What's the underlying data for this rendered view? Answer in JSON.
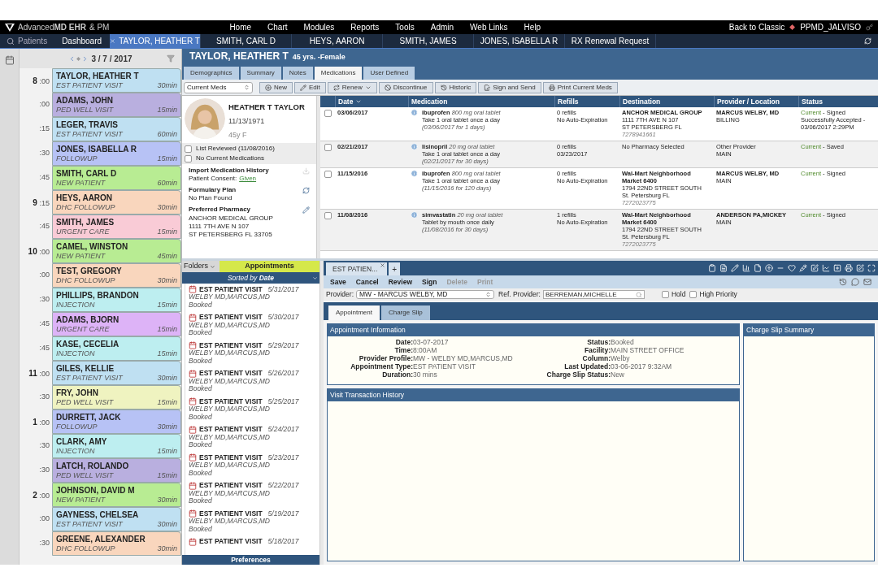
{
  "top_bar": {
    "logo": "Advanced**MD EHR**",
    "logo_suffix": "& PM",
    "menu": [
      "Home",
      "Chart",
      "Modules",
      "Reports",
      "Tools",
      "Admin",
      "Web Links",
      "Help"
    ],
    "back_link": "Back to Classic",
    "user": "PPMD_JALVISO"
  },
  "tab_bar": {
    "search_label": "Patients",
    "dashboard": "Dashboard",
    "tabs": [
      {
        "label": "TAYLOR, HEATHER T",
        "selected": true
      },
      {
        "label": "SMITH, CARL D",
        "selected": false
      },
      {
        "label": "HEYS, AARON",
        "selected": false
      },
      {
        "label": "SMITH, JAMES",
        "selected": false
      },
      {
        "label": "JONES, ISABELLA R",
        "selected": false
      },
      {
        "label": "RX Renewal Request",
        "selected": false
      }
    ]
  },
  "schedule": {
    "date": "3 / 7 / 2017",
    "appointments": [
      {
        "hour": "8",
        "minute": ":00",
        "name": "TAYLOR, HEATHER T",
        "type": "EST PATIENT VISIT",
        "duration": "30min",
        "color": "#bfe0f2"
      },
      {
        "minute": ":00",
        "name": "ADAMS, JOHN",
        "type": "PED WELL VISIT",
        "duration": "15min",
        "color": "#b9afdf"
      },
      {
        "minute": ":15",
        "name": "LEGER, TRAVIS",
        "type": "EST PATIENT VISIT",
        "duration": "60min",
        "color": "#bfe0f2"
      },
      {
        "minute": ":30",
        "name": "JONES, ISABELLA R",
        "type": "FOLLOWUP",
        "duration": "15min",
        "color": "#b7c2f5"
      },
      {
        "minute": ":45",
        "name": "SMITH, CARL D",
        "type": "NEW PATIENT",
        "duration": "60min",
        "color": "#b8ec93"
      },
      {
        "hour": "9",
        "minute": ":15",
        "name": "HEYS, AARON",
        "type": "DHC FOLLOWUP",
        "duration": "30min",
        "color": "#f9d6bd"
      },
      {
        "minute": ":45",
        "name": "SMITH, JAMES",
        "type": "URGENT CARE",
        "duration": "15min",
        "color": "#f9cbd6"
      },
      {
        "hour": "10",
        "minute": ":00",
        "name": "CAMEL, WINSTON",
        "type": "NEW PATIENT",
        "duration": "45min",
        "color": "#b8ec93"
      },
      {
        "minute": ":00",
        "name": "TEST, GREGORY",
        "type": "DHC FOLLOWUP",
        "duration": "30min",
        "color": "#f9d6bd"
      },
      {
        "minute": ":30",
        "name": "PHILLIPS, BRANDON",
        "type": "INJECTION",
        "duration": "15min",
        "color": "#bdeef0"
      },
      {
        "minute": ":45",
        "name": "ADAMS, BJORN",
        "type": "URGENT CARE",
        "duration": "15min",
        "color": "#ddb3f7"
      },
      {
        "minute": ":45",
        "name": "KASE, CECELIA",
        "type": "INJECTION",
        "duration": "15min",
        "color": "#bdeef0"
      },
      {
        "hour": "11",
        "minute": ":00",
        "name": "GILES, KELLIE",
        "type": "EST PATIENT VISIT",
        "duration": "30min",
        "color": "#bfe0f2"
      },
      {
        "minute": ":30",
        "name": "FRY, JOHN",
        "type": "PED WELL VISIT",
        "duration": "15min",
        "color": "#eff3c0"
      },
      {
        "hour": "1",
        "minute": ":00",
        "name": "DURRETT, JACK",
        "type": "FOLLOWUP",
        "duration": "30min",
        "color": "#b7c2f5"
      },
      {
        "minute": ":30",
        "name": "CLARK, AMY",
        "type": "INJECTION",
        "duration": "15min",
        "color": "#bdeef0"
      },
      {
        "minute": ":30",
        "name": "LATCH, ROLANDO",
        "type": "PED WELL VISIT",
        "duration": "15min",
        "color": "#b9afdf"
      },
      {
        "hour": "2",
        "minute": ":00",
        "name": "JOHNSON, DAVID M",
        "type": "NEW PATIENT",
        "duration": "30min",
        "color": "#b8ec93"
      },
      {
        "minute": ":00",
        "name": "GAYNESS, CHELSEA",
        "type": "EST PATIENT VISIT",
        "duration": "30min",
        "color": "#bfe0f2"
      },
      {
        "minute": ":30",
        "name": "GREENE, ALEXANDER",
        "type": "DHC FOLLOWUP",
        "duration": "30min",
        "color": "#f9d6bd"
      }
    ]
  },
  "patient_header": {
    "name": "TAYLOR, HEATHER T",
    "info": "45 yrs. -Female"
  },
  "chart_tabs": [
    {
      "label": "Demographics",
      "selected": false
    },
    {
      "label": "Summary",
      "selected": false
    },
    {
      "label": "Notes",
      "selected": false
    },
    {
      "label": "Medications",
      "selected": true
    },
    {
      "label": "User Defined",
      "selected": false
    }
  ],
  "med_toolbar": {
    "filter": "Current Meds",
    "buttons": [
      {
        "label": "New",
        "kind": "new"
      },
      {
        "label": "Edit",
        "kind": "edit"
      },
      {
        "label": "Renew",
        "kind": "renew"
      },
      {
        "label": "Discontinue",
        "kind": "discontinue"
      },
      {
        "label": "Historic",
        "kind": "historic"
      },
      {
        "label": "Sign and Send",
        "kind": "sign"
      },
      {
        "label": "Print Current Meds",
        "kind": "print"
      }
    ]
  },
  "patient_card": {
    "name": "HEATHER T TAYLOR",
    "dob": "11/13/1971",
    "age_sex": "45y F",
    "checks": [
      {
        "label": "List Reviewed (11/08/2016)",
        "checked": false
      },
      {
        "label": "No Current Medications",
        "checked": false
      }
    ],
    "import_title": "Import Medication History",
    "consent_label": "Patient Consent:",
    "consent_value": "Given",
    "formulary_title": "Formulary Plan",
    "formulary_value": "No Plan Found",
    "pharmacy_title": "Preferred Pharmacy",
    "pharmacy_lines": [
      "ANCHOR MEDICAL GROUP",
      "1111 7TH AVE N 107",
      "ST PETERSBERG FL 33705"
    ]
  },
  "medications": {
    "columns": [
      "Date",
      "Medication",
      "Refills",
      "Destination",
      "Provider / Location",
      "Status"
    ],
    "rows": [
      {
        "checked": false,
        "date": "03/06/2017",
        "drug": "ibuprofen",
        "strength": "800 mg oral tablet",
        "sig": "Take 1 oral tablet once a day",
        "period": "(03/06/2017 for 1 days)",
        "refills": [
          "0 refills",
          "No Auto-Expiration"
        ],
        "destination_name": "ANCHOR MEDICAL GROUP",
        "destination_lines": [
          "1111 7TH AVE N 107",
          "ST PETERSBERG  FL"
        ],
        "phone": "7278941661",
        "provider": "MARCUS WELBY, MD",
        "provider_emphasized": true,
        "location": "BILLING",
        "status": "Current",
        "status_detail": "- Signed",
        "status_extra": "Successfully Accepted - 03/06/2017 2:29PM"
      },
      {
        "checked": false,
        "date": "02/21/2017",
        "drug": "lisinopril",
        "strength": "20 mg oral tablet",
        "sig": "Take 1 oral tablet once a day",
        "period": "(02/21/2017 for 30 days)",
        "refills": [
          "0 refills",
          "03/23/2017"
        ],
        "destination_lines": [
          "No Pharmacy Selected"
        ],
        "provider": "Other Provider",
        "provider_emphasized": false,
        "location": "MAIN",
        "status": "Current",
        "status_detail": "- Saved"
      },
      {
        "checked": false,
        "date": "11/15/2016",
        "drug": "ibuprofen",
        "strength": "800 mg oral tablet",
        "sig": "Take 1 oral tablet once a day",
        "period": "(11/15/2016 for 120 days)",
        "refills": [
          "0 refills",
          "No Auto-Expiration"
        ],
        "destination_name": "Wal-Mart Neighborhood Market 6400",
        "destination_lines": [
          "1794 22ND STREET SOUTH",
          "St. Petersburg  FL"
        ],
        "phone": "7272023775",
        "provider": "MARCUS WELBY, MD",
        "provider_emphasized": true,
        "location": "MAIN",
        "status": "Current",
        "status_detail": "- Signed"
      },
      {
        "checked": false,
        "date": "11/08/2016",
        "drug": "simvastatin",
        "strength": "20 mg oral tablet",
        "sig": "Tablet by mouth once daily",
        "period": "(11/08/2016 for 30 days)",
        "refills": [
          "1 refills",
          "No Auto-Expiration"
        ],
        "destination_name": "Wal-Mart Neighborhood Market 6400",
        "destination_lines": [
          "1794 22ND STREET SOUTH",
          "St. Petersburg  FL"
        ],
        "phone": "7272023775",
        "provider": "ANDERSON PA,MICKEY",
        "provider_emphasized": true,
        "location": "MAIN",
        "status": "Current",
        "status_detail": "- Signed"
      }
    ]
  },
  "folders": {
    "folders_label": "Folders",
    "appointments_label": "Appointments",
    "sort_label": "Sorted by **Date**",
    "items": [
      {
        "title": "EST PATIENT VISIT",
        "date": "5/31/2017",
        "doctor": "WELBY MD,MARCUS,MD",
        "status": "Booked"
      },
      {
        "title": "EST PATIENT VISIT",
        "date": "5/30/2017",
        "doctor": "WELBY MD,MARCUS,MD",
        "status": "Booked"
      },
      {
        "title": "EST PATIENT VISIT",
        "date": "5/29/2017",
        "doctor": "WELBY MD,MARCUS,MD",
        "status": "Booked"
      },
      {
        "title": "EST PATIENT VISIT",
        "date": "5/26/2017",
        "doctor": "WELBY MD,MARCUS,MD",
        "status": "Booked"
      },
      {
        "title": "EST PATIENT VISIT",
        "date": "5/25/2017",
        "doctor": "WELBY MD,MARCUS,MD",
        "status": "Booked"
      },
      {
        "title": "EST PATIENT VISIT",
        "date": "5/24/2017",
        "doctor": "WELBY MD,MARCUS,MD",
        "status": "Booked"
      },
      {
        "title": "EST PATIENT VISIT",
        "date": "5/23/2017",
        "doctor": "WELBY MD,MARCUS,MD",
        "status": "Booked"
      },
      {
        "title": "EST PATIENT VISIT",
        "date": "5/22/2017",
        "doctor": "WELBY MD,MARCUS,MD",
        "status": "Booked"
      },
      {
        "title": "EST PATIENT VISIT",
        "date": "5/19/2017",
        "doctor": "WELBY MD,MARCUS,MD",
        "status": "Booked"
      },
      {
        "title": "EST PATIENT VISIT",
        "date": "5/18/2017"
      }
    ],
    "preferences": "Preferences"
  },
  "visit": {
    "tab": "EST PATIEN...",
    "add": "+",
    "actions": [
      {
        "label": "Save",
        "disabled": false
      },
      {
        "label": "Cancel",
        "disabled": false
      },
      {
        "label": "Review",
        "disabled": false
      },
      {
        "label": "Sign",
        "disabled": false
      },
      {
        "label": "Delete",
        "disabled": true
      },
      {
        "label": "Print",
        "disabled": true
      }
    ],
    "provider_label": "Provider:",
    "provider": "MW - MARCUS WELBY, MD",
    "ref_label": "Ref. Provider:",
    "ref_provider": "BERREMAN,MICHELLE",
    "flags": [
      {
        "label": "Hold",
        "checked": false
      },
      {
        "label": "High Priority",
        "checked": false
      }
    ],
    "tabs": [
      {
        "label": "Appointment",
        "selected": true
      },
      {
        "label": "Charge Slip",
        "selected": false
      }
    ],
    "info_title": "Appointment Information",
    "info_left": [
      {
        "label": "Date:",
        "value": "03-07-2017"
      },
      {
        "label": "Time:",
        "value": "8:00AM"
      },
      {
        "label": "Provider Profile:",
        "value": "MW - WELBY MD,MARCUS,MD"
      },
      {
        "label": "Appointment Type:",
        "value": "EST PATIENT VISIT"
      },
      {
        "label": "Duration:",
        "value": "30 mins"
      }
    ],
    "info_right": [
      {
        "label": "Status:",
        "value": "Booked"
      },
      {
        "label": "Facility:",
        "value": "MAIN STREET OFFICE"
      },
      {
        "label": "Column:",
        "value": "Welby"
      },
      {
        "label": "Last Updated:",
        "value": "03-06-2017 9:32AM"
      },
      {
        "label": "Charge Slip Status:",
        "value": "New"
      }
    ],
    "history_title": "Visit Transaction History",
    "summary_title": "Charge Slip Summary"
  }
}
